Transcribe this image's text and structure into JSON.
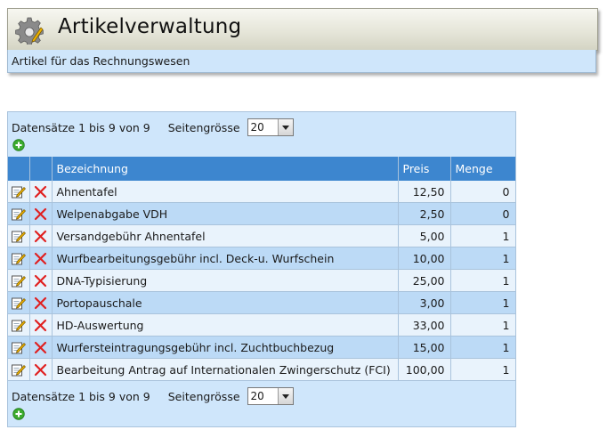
{
  "header": {
    "title": "Artikelverwaltung",
    "subtitle": "Artikel für das Rechnungswesen",
    "icon": "gear-pencil-icon"
  },
  "pager_top": {
    "records_label": "Datensätze 1 bis 9 von 9",
    "page_size_label": "Seitengrösse",
    "page_size_value": "20"
  },
  "pager_bottom": {
    "records_label": "Datensätze 1 bis 9 von 9",
    "page_size_label": "Seitengrösse",
    "page_size_value": "20"
  },
  "table": {
    "columns": [
      "",
      "",
      "Bezeichnung",
      "Preis",
      "Menge"
    ],
    "rows": [
      {
        "name": "Ahnentafel",
        "price": "12,50",
        "qty": "0"
      },
      {
        "name": "Welpenabgabe VDH",
        "price": "2,50",
        "qty": "0"
      },
      {
        "name": "Versandgebühr Ahnentafel",
        "price": "5,00",
        "qty": "1"
      },
      {
        "name": "Wurfbearbeitungsgebühr incl. Deck-u. Wurfschein",
        "price": "10,00",
        "qty": "1"
      },
      {
        "name": "DNA-Typisierung",
        "price": "25,00",
        "qty": "1"
      },
      {
        "name": "Portopauschale",
        "price": "3,00",
        "qty": "1"
      },
      {
        "name": "HD-Auswertung",
        "price": "33,00",
        "qty": "1"
      },
      {
        "name": "Wurfersteintragungsgebühr incl. Zuchtbuchbezug",
        "price": "15,00",
        "qty": "1"
      },
      {
        "name": "Bearbeitung Antrag auf Internationalen Zwingerschutz (FCI)",
        "price": "100,00",
        "qty": "1"
      }
    ]
  },
  "colors": {
    "header_bg": "#e6e6d9",
    "panel_bg": "#cfe6fb",
    "table_header_bg": "#3d86cf",
    "row_light": "#e9f3fc",
    "row_dark": "#bcdaf6",
    "delete_red": "#e02020",
    "add_green": "#3cab2e"
  }
}
